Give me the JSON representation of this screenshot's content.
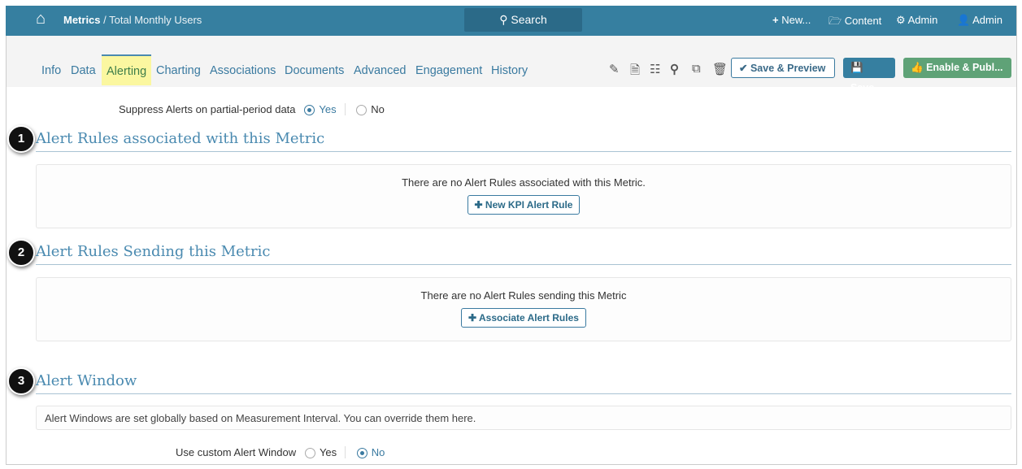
{
  "header": {
    "breadcrumb_root": "Metrics",
    "breadcrumb_sep": " / ",
    "breadcrumb_page": "Total Monthly Users",
    "search": "Search",
    "new": "New...",
    "content": "Content",
    "admin_settings": "Admin",
    "admin_user": "Admin"
  },
  "tabs": [
    "Info",
    "Data",
    "Alerting",
    "Charting",
    "Associations",
    "Documents",
    "Advanced",
    "Engagement",
    "History"
  ],
  "toolbar": {
    "save_preview": "Save & Preview",
    "save": "Save",
    "enable_publish": "Enable & Publ..."
  },
  "suppress": {
    "label": "Suppress Alerts on partial-period data",
    "yes": "Yes",
    "no": "No",
    "selected": "Yes"
  },
  "sections": [
    {
      "badge": "1",
      "title": "Alert Rules associated with this Metric",
      "message": "There are no Alert Rules associated with this Metric.",
      "button": "New KPI Alert Rule"
    },
    {
      "badge": "2",
      "title": "Alert Rules Sending this Metric",
      "message": "There are no Alert Rules sending this Metric",
      "button": "Associate Alert Rules"
    },
    {
      "badge": "3",
      "title": "Alert Window",
      "message": "Alert Windows are set globally based on Measurement Interval. You can override them here."
    }
  ],
  "custom_window": {
    "label": "Use custom Alert Window",
    "yes": "Yes",
    "no": "No",
    "selected": "No"
  }
}
